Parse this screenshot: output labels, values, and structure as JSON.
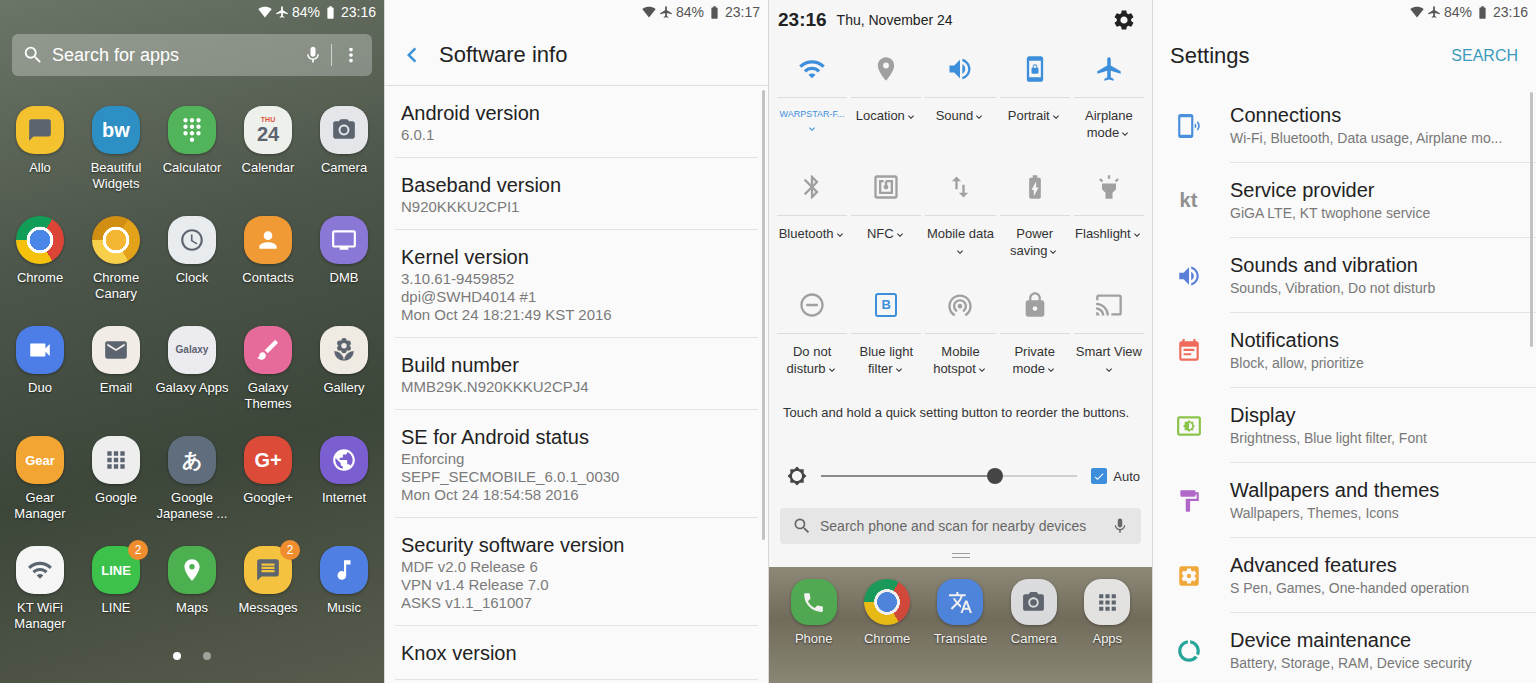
{
  "app_drawer": {
    "status_bar": {
      "battery": "84%",
      "time": "23:16"
    },
    "search": {
      "placeholder": "Search for apps"
    },
    "apps": [
      {
        "label": "Allo",
        "kind": "icon",
        "color": "#f4c12f"
      },
      {
        "label": "Beautiful Widgets",
        "kind": "glyph",
        "glyph": "bw",
        "color": "#2d8fc4"
      },
      {
        "label": "Calculator",
        "kind": "icon",
        "color": "#52b45a"
      },
      {
        "label": "Calendar",
        "kind": "glyph",
        "glyph": "24",
        "caption": "THU",
        "color": "#eef0ec"
      },
      {
        "label": "Camera",
        "kind": "icon",
        "color": "#e4e6ea"
      },
      {
        "label": "Chrome",
        "kind": "chrome",
        "color": "#4a86e8",
        "ring": [
          "#db4437",
          "#f4c20d",
          "#0f9d58"
        ]
      },
      {
        "label": "Chrome Canary",
        "kind": "chrome",
        "color": "#f2b632",
        "ring": [
          "#e3a21a",
          "#f7cf4a",
          "#d28e12"
        ]
      },
      {
        "label": "Clock",
        "kind": "icon",
        "color": "#e9ecef"
      },
      {
        "label": "Contacts",
        "kind": "icon",
        "color": "#f09a36"
      },
      {
        "label": "DMB",
        "kind": "icon",
        "color": "#8b78d6"
      },
      {
        "label": "Duo",
        "kind": "icon",
        "color": "#4d7ee8"
      },
      {
        "label": "Email",
        "kind": "icon",
        "color": "#f1ece6"
      },
      {
        "label": "Galaxy Apps",
        "kind": "glyph",
        "glyph": "Galaxy",
        "color": "#ecebf0"
      },
      {
        "label": "Galaxy Themes",
        "kind": "icon",
        "color": "#e66a9a"
      },
      {
        "label": "Gallery",
        "kind": "icon",
        "color": "#efeae2"
      },
      {
        "label": "Gear Manager",
        "kind": "glyph",
        "glyph": "Gear",
        "color": "#f3a533"
      },
      {
        "label": "Google",
        "kind": "icon",
        "color": "#eeeeee"
      },
      {
        "label": "Google Japanese ...",
        "kind": "glyph",
        "glyph": "あ",
        "color": "#5f6d7c"
      },
      {
        "label": "Google+",
        "kind": "glyph",
        "glyph": "G+",
        "color": "#dc4a38"
      },
      {
        "label": "Internet",
        "kind": "icon",
        "color": "#7b5fd0"
      },
      {
        "label": "KT WiFi Manager",
        "kind": "icon",
        "color": "#f5f5f5"
      },
      {
        "label": "LINE",
        "kind": "glyph",
        "glyph": "LINE",
        "color": "#3cc14a",
        "badge": "2"
      },
      {
        "label": "Maps",
        "kind": "icon",
        "color": "#4caf50"
      },
      {
        "label": "Messages",
        "kind": "icon",
        "color": "#f4c23e",
        "badge": "2"
      },
      {
        "label": "Music",
        "kind": "icon",
        "color": "#4f7fe3"
      }
    ],
    "pages": [
      {
        "selected": true
      },
      {
        "selected": false
      }
    ]
  },
  "software_info": {
    "status_bar": {
      "battery": "84%",
      "time": "23:17"
    },
    "title": "Software info",
    "items": [
      {
        "title": "Android version",
        "lines": [
          "6.0.1"
        ]
      },
      {
        "title": "Baseband version",
        "lines": [
          "N920KKKU2CPI1"
        ]
      },
      {
        "title": "Kernel version",
        "lines": [
          "3.10.61-9459852",
          "dpi@SWHD4014 #1",
          "Mon Oct 24 18:21:49 KST 2016"
        ]
      },
      {
        "title": "Build number",
        "lines": [
          "MMB29K.N920KKKU2CPJ4"
        ]
      },
      {
        "title": "SE for Android status",
        "lines": [
          "Enforcing",
          "SEPF_SECMOBILE_6.0.1_0030",
          "Mon Oct 24 18:54:58 2016"
        ]
      },
      {
        "title": "Security software version",
        "lines": [
          "MDF v2.0 Release 6",
          "VPN v1.4 Release 7.0",
          "ASKS v1.1_161007"
        ]
      },
      {
        "title": "Knox version",
        "lines": []
      }
    ]
  },
  "quick_panel": {
    "time": "23:16",
    "date": "Thu, November 24",
    "tiles": [
      {
        "label": "WARPSTAR-F...",
        "kind": "network",
        "on": true
      },
      {
        "label": "Location",
        "kind": "toggle",
        "on": false
      },
      {
        "label": "Sound",
        "kind": "toggle",
        "on": true
      },
      {
        "label": "Portrait",
        "kind": "toggle",
        "on": true
      },
      {
        "label": "Airplane mode",
        "kind": "toggle",
        "on": true
      },
      {
        "label": "Bluetooth",
        "kind": "toggle",
        "on": false
      },
      {
        "label": "NFC",
        "kind": "toggle",
        "on": false
      },
      {
        "label": "Mobile data",
        "kind": "toggle",
        "on": false
      },
      {
        "label": "Power saving",
        "kind": "toggle",
        "on": false
      },
      {
        "label": "Flashlight",
        "kind": "toggle",
        "on": false
      },
      {
        "label": "Do not disturb",
        "kind": "toggle",
        "on": false
      },
      {
        "label": "Blue light filter",
        "kind": "glyph",
        "glyph": "B",
        "on": true
      },
      {
        "label": "Mobile hotspot",
        "kind": "toggle",
        "on": false
      },
      {
        "label": "Private mode",
        "kind": "toggle",
        "on": false
      },
      {
        "label": "Smart View",
        "kind": "toggle",
        "on": false
      }
    ],
    "hint": "Touch and hold a quick setting button to reorder the buttons.",
    "brightness": {
      "level": 0.68,
      "auto": true,
      "auto_label": "Auto"
    },
    "search": {
      "placeholder": "Search phone and scan for nearby devices"
    },
    "dock": [
      {
        "label": "Phone",
        "kind": "icon",
        "color": "#4caf50"
      },
      {
        "label": "Chrome",
        "kind": "chrome",
        "color": "#4a86e8",
        "ring": [
          "#db4437",
          "#f4c20d",
          "#0f9d58"
        ]
      },
      {
        "label": "Translate",
        "kind": "icon",
        "color": "#4a86e8"
      },
      {
        "label": "Camera",
        "kind": "icon",
        "color": "#e4e6ea"
      },
      {
        "label": "Apps",
        "kind": "icon",
        "color": "#eeeeee"
      }
    ]
  },
  "settings": {
    "status_bar": {
      "battery": "84%",
      "time": "23:16"
    },
    "title": "Settings",
    "search_label": "SEARCH",
    "items": [
      {
        "title": "Connections",
        "subtitle": "Wi-Fi, Bluetooth, Data usage, Airplane mo...",
        "kind": "icon",
        "color": "#4a8fdc"
      },
      {
        "title": "Service provider",
        "subtitle": "GiGA LTE, KT twophone service",
        "kind": "glyph",
        "glyph": "kt",
        "color": "#8f8f8f"
      },
      {
        "title": "Sounds and vibration",
        "subtitle": "Sounds, Vibration, Do not disturb",
        "kind": "icon",
        "color": "#5b7fd9"
      },
      {
        "title": "Notifications",
        "subtitle": "Block, allow, prioritize",
        "kind": "icon",
        "color": "#ef6a5a"
      },
      {
        "title": "Display",
        "subtitle": "Brightness, Blue light filter, Font",
        "kind": "icon",
        "color": "#8bc34a"
      },
      {
        "title": "Wallpapers and themes",
        "subtitle": "Wallpapers, Themes, Icons",
        "kind": "icon",
        "color": "#b067c9"
      },
      {
        "title": "Advanced features",
        "subtitle": "S Pen, Games, One-handed operation",
        "kind": "icon",
        "color": "#f0a83a"
      },
      {
        "title": "Device maintenance",
        "subtitle": "Battery, Storage, RAM, Device security",
        "kind": "icon",
        "color": "#26a69a"
      }
    ]
  }
}
